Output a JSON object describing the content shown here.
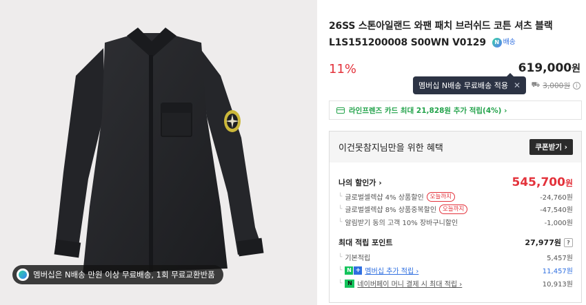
{
  "product": {
    "title": "26SS 스톤아일랜드 와팬 패치 브러쉬드 코튼 셔츠 블랙 L1S151200008 S00WN V0129",
    "delivery_badge": "배송",
    "delivery_badge_icon": "N",
    "image_alt": "black cotton overshirt with compass patch"
  },
  "promo_pill": {
    "text": "멤버십은 N배송 만원 이상 무료배송, 1회 무료교환반품"
  },
  "pricing": {
    "discount_rate": "11%",
    "price": "619,000",
    "currency": "원"
  },
  "shipping_tooltip": {
    "text": "멤버십 N배송 무료배송 적용",
    "close": "✕"
  },
  "shipping_fee": {
    "original": "3,000원",
    "info": "i"
  },
  "card_promo": {
    "text": "라인프렌즈 카드 최대 21,828원 추가 적립(4%) ›"
  },
  "benefit": {
    "title": "이건못참지님만을 위한 혜택",
    "coupon_button": "쿠폰받기 ›",
    "my_price_label": "나의 할인가 ›",
    "my_price": "545,700",
    "my_price_currency": "원",
    "today_tag": "오늘까지",
    "discounts": [
      {
        "label": "글로벌셀렉샵 4% 상품할인",
        "value": "-24,760원"
      },
      {
        "label": "글로벌셀렉샵 8% 상품중복할인",
        "value": "-47,540원"
      },
      {
        "label": "알림받기 동의 고객 10% 장바구니할인",
        "value": "-1,000원"
      }
    ],
    "points_label": "최대 적립 포인트",
    "points_total": "27,977원",
    "points_help": "?",
    "points": [
      {
        "label": "기본적립",
        "value": "5,457원"
      },
      {
        "label": "멤버십 추가 적립 ›",
        "value": "11,457원"
      },
      {
        "label": "네이버페이 머니 결제 시 최대 적립 ›",
        "value": "10,913원"
      }
    ]
  },
  "colors": {
    "accent_red": "#e3323b",
    "accent_green": "#23a34b",
    "accent_blue": "#2f6fe0",
    "tooltip_bg": "#2c3344"
  }
}
